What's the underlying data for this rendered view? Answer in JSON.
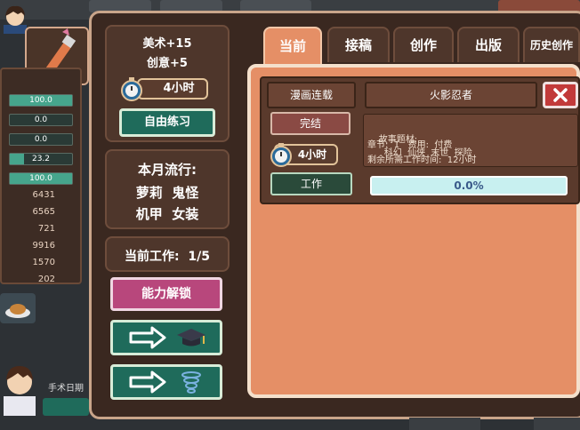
{
  "left_panel": {
    "stat_bars": [
      {
        "value": "100.0",
        "fill": 1.0
      },
      {
        "value": "0.0",
        "fill": 0.0
      },
      {
        "value": "0.0",
        "fill": 0.0
      },
      {
        "value": "23.2",
        "fill": 0.232
      },
      {
        "value": "100.0",
        "fill": 1.0
      }
    ],
    "stats": [
      "6431",
      "6565",
      "721",
      "9916",
      "1570",
      "202"
    ],
    "date_label": "手术日期"
  },
  "side": {
    "art_bonus": "美术+15",
    "creativity_bonus": "创意+5",
    "practice_time": "4小时",
    "free_practice_label": "自由练习",
    "trend_title": "本月流行:",
    "trend_line1": "萝莉  鬼怪",
    "trend_line2": "机甲  女装",
    "current_work": "当前工作:  1/5",
    "unlock_label": "能力解锁"
  },
  "tabs": [
    {
      "label": "当前",
      "active": true
    },
    {
      "label": "接稿",
      "active": false
    },
    {
      "label": "创作",
      "active": false
    },
    {
      "label": "出版",
      "active": false
    },
    {
      "label": "历史创作",
      "active": false
    }
  ],
  "job": {
    "type": "漫画连载",
    "title": "火影忍者",
    "finish_label": "完结",
    "time": "4小时",
    "work_label": "工作",
    "progress": "0.0%",
    "progress_fraction": 0.0,
    "themes_label": "故事题材:",
    "themes": "科幻  仙侠  末世  探险",
    "chapter_line": "章节:  1   费用:  付费",
    "remaining_line": "剩余所需工作时间:  12小时"
  }
}
